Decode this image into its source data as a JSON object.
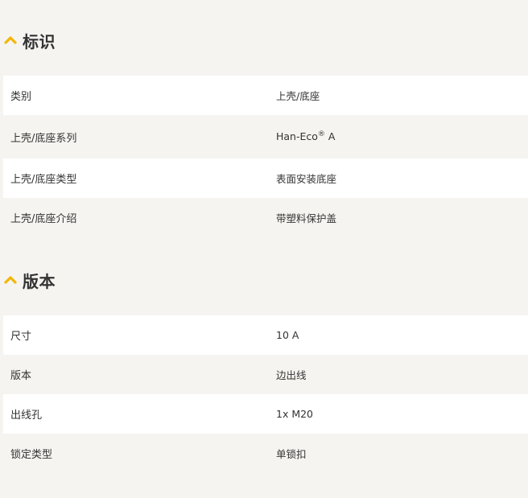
{
  "sections": [
    {
      "title": "标识",
      "rows": [
        {
          "key": "类别",
          "value": "上壳/底座"
        },
        {
          "key": "上壳/底座系列",
          "value": "Han-Eco",
          "sup": "®",
          "suffix": " A"
        },
        {
          "key": "上壳/底座类型",
          "value": "表面安装底座"
        },
        {
          "key": "上壳/底座介绍",
          "value": "带塑料保护盖"
        }
      ]
    },
    {
      "title": "版本",
      "rows": [
        {
          "key": "尺寸",
          "value": "10 A"
        },
        {
          "key": "版本",
          "value": "边出线"
        },
        {
          "key": "出线孔",
          "value": "1x M20"
        },
        {
          "key": "锁定类型",
          "value": "单锁扣"
        }
      ]
    }
  ],
  "colors": {
    "accent": "#f2b705",
    "row_white": "#ffffff",
    "row_alt": "#f5f4f1",
    "text": "#333333"
  },
  "icons": {
    "section_toggle": "chevron-up-icon"
  }
}
